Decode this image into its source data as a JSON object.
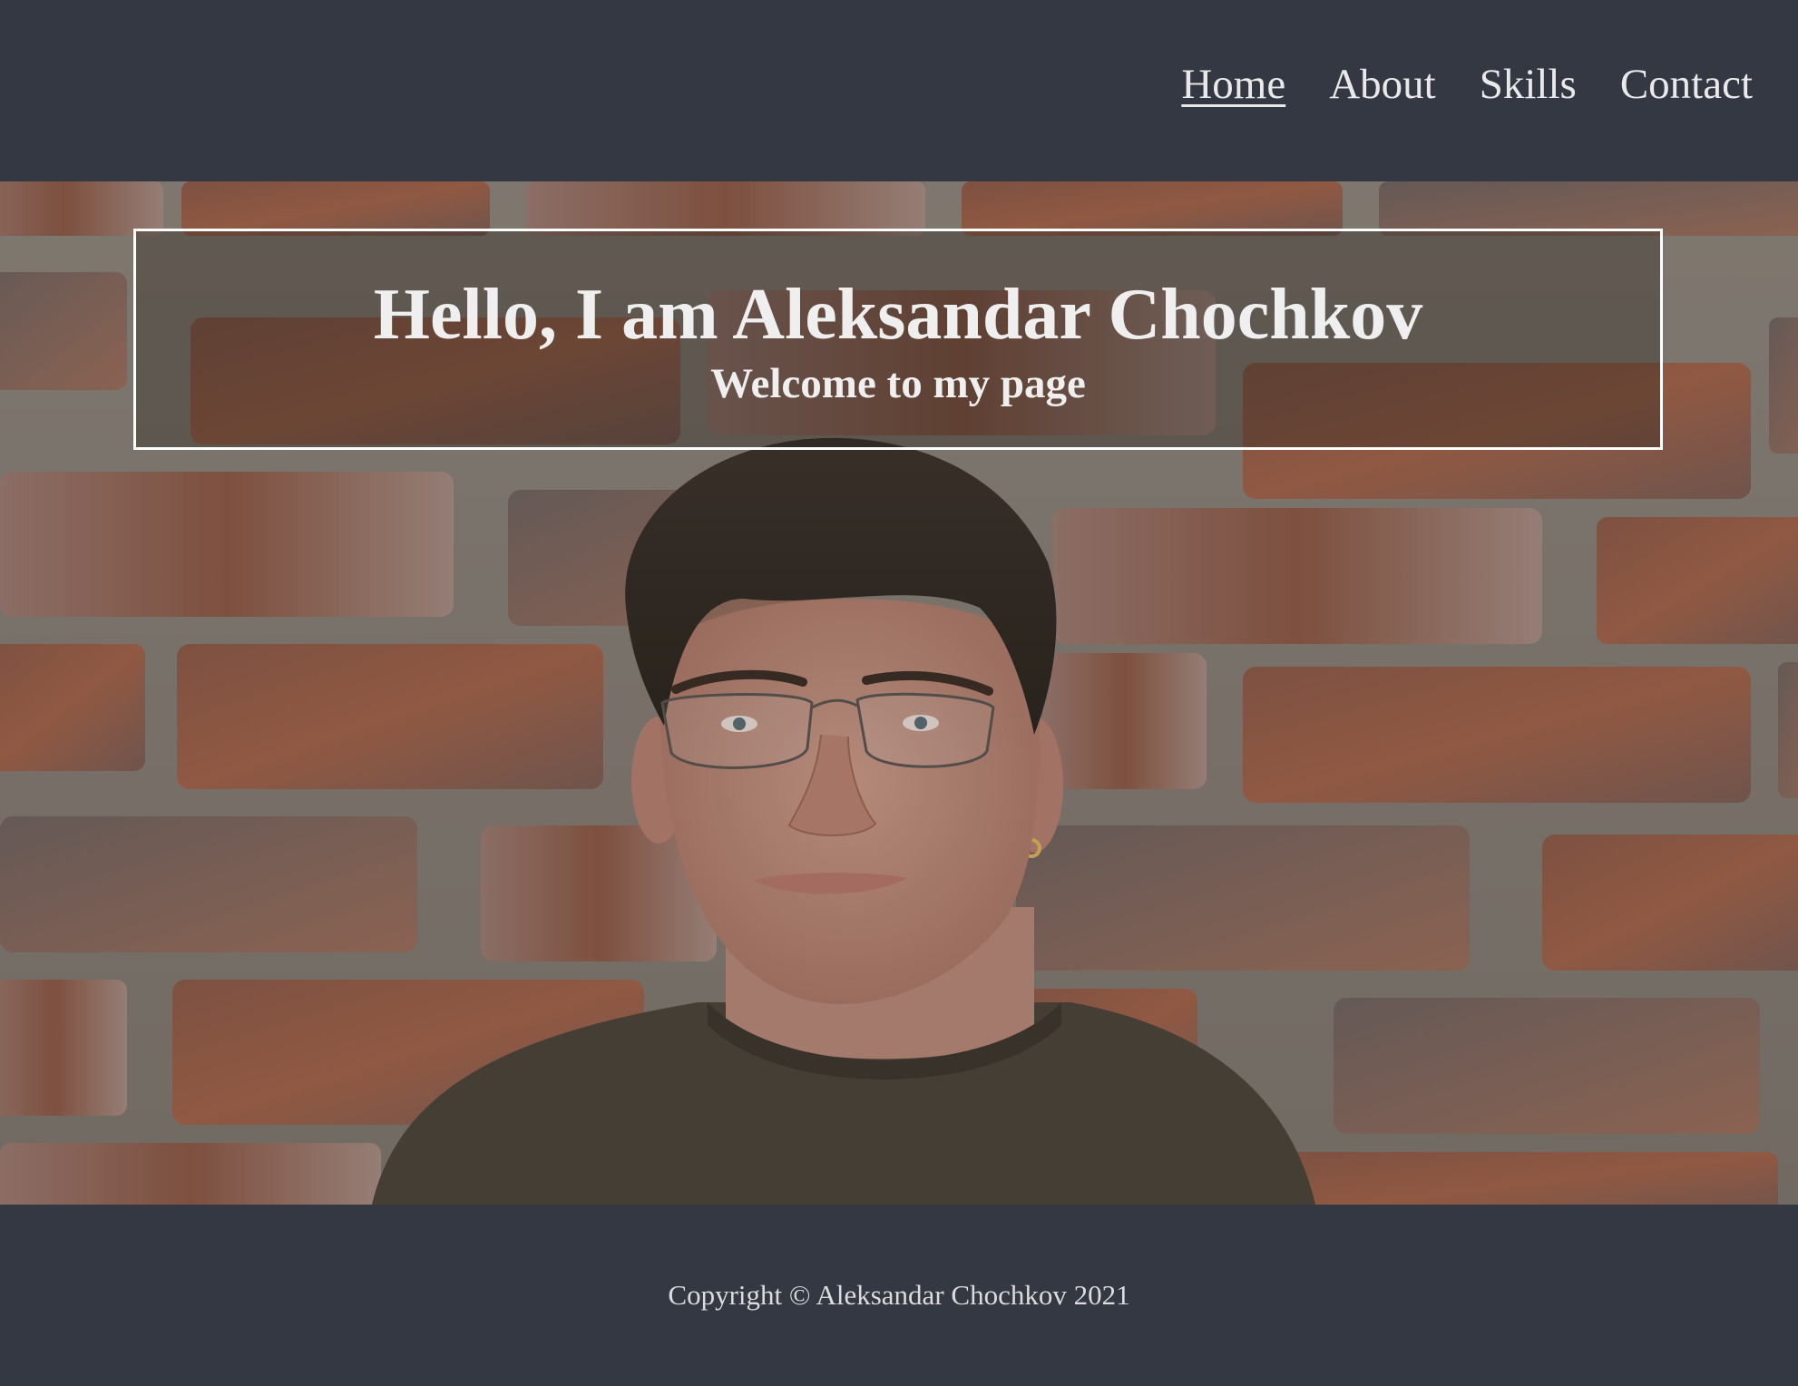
{
  "nav": {
    "items": [
      {
        "label": "Home",
        "active": true
      },
      {
        "label": "About",
        "active": false
      },
      {
        "label": "Skills",
        "active": false
      },
      {
        "label": "Contact",
        "active": false
      }
    ]
  },
  "hero": {
    "title": "Hello, I am Aleksandar Chochkov",
    "subtitle": "Welcome to my page",
    "image_alt": "portrait-photo",
    "image_description_icon": "portrait-photo-brick-wall"
  },
  "footer": {
    "copyright": "Copyright © Aleksandar Chochkov 2021"
  },
  "colors": {
    "header_bg": "#333842",
    "footer_bg": "#333842",
    "text_light": "#e9e9e9",
    "box_border": "#ffffff"
  }
}
